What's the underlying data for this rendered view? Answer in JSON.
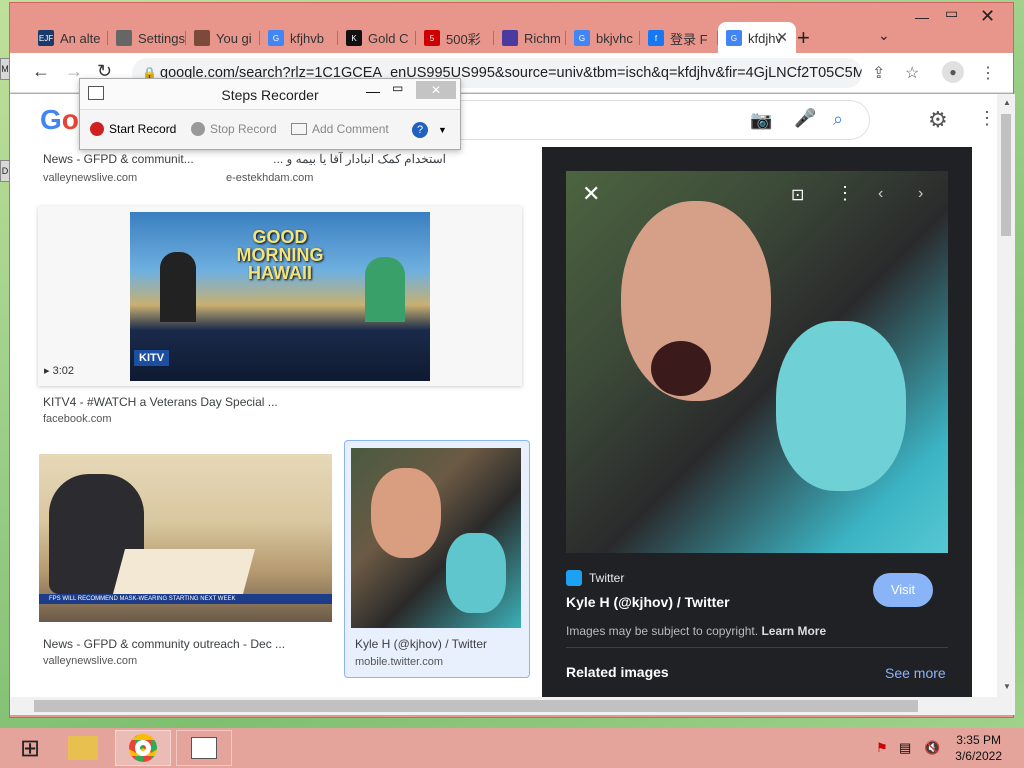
{
  "tabs": [
    {
      "label": "An alte",
      "favicon": "EJF",
      "color": "#1a3a6a"
    },
    {
      "label": "Settings",
      "favicon": "gear-icon",
      "color": "#666"
    },
    {
      "label": "You gi",
      "favicon": "avatar",
      "color": "#7a4a3a"
    },
    {
      "label": "kfjhvb",
      "favicon": "G",
      "color": "#4285f4"
    },
    {
      "label": "Gold C",
      "favicon": "K",
      "color": "#111"
    },
    {
      "label": "500彩",
      "favicon": "5",
      "color": "#c00"
    },
    {
      "label": "Richm",
      "favicon": "bookmark",
      "color": "#4a3aa0"
    },
    {
      "label": "bkjvhc",
      "favicon": "G",
      "color": "#4285f4"
    },
    {
      "label": "登录 F",
      "favicon": "f",
      "color": "#1877f2"
    },
    {
      "label": "kfdjhv",
      "favicon": "G",
      "color": "#4285f4"
    }
  ],
  "url": "google.com/search?rlz=1C1GCEA_enUS995US995&source=univ&tbm=isch&q=kfdjhv&fir=4GjLNCf2T05C5M%...",
  "steps_recorder": {
    "title": "Steps Recorder",
    "start": "Start Record",
    "stop": "Stop Record",
    "comment": "Add Comment"
  },
  "results": {
    "top_left_title": "News - GFPD & communit...",
    "top_left_src": "valleynewslive.com",
    "top_right_title": "استخدام کمک انبادار آقا یا بیمه و ...",
    "top_right_src": "e-estekhdam.com",
    "video_duration": "3:02",
    "video_overlay": "GOOD MORNING HAWAII",
    "video_logo": "KITV",
    "video_title": "KITV4 - #WATCH a Veterans Day Special ...",
    "video_src": "facebook.com",
    "class_title": "News - GFPD & community outreach - Dec ...",
    "class_src": "valleynewslive.com",
    "class_banner": "FPS WILL RECOMMEND MASK-WEARING STARTING NEXT WEEK",
    "kyle_title": "Kyle H (@kjhov) / Twitter",
    "kyle_src": "mobile.twitter.com"
  },
  "panel": {
    "source": "Twitter",
    "title": "Kyle H (@kjhov) / Twitter",
    "visit": "Visit",
    "copyright": "Images may be subject to copyright.",
    "learn_more": "Learn More",
    "related": "Related images",
    "see_more": "See more"
  },
  "clock": {
    "time": "3:35 PM",
    "date": "3/6/2022"
  },
  "colors": {
    "accent": "#8ab4f8",
    "window_frame": "#e8968c",
    "panel_bg": "#202124"
  }
}
